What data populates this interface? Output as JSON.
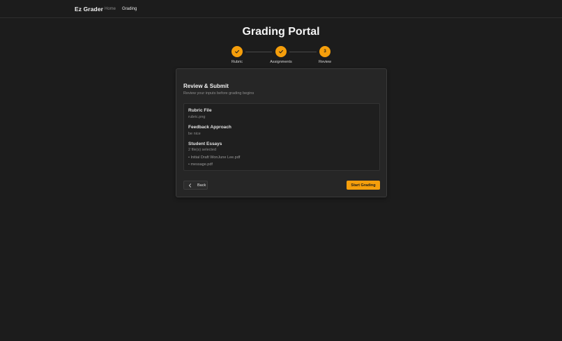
{
  "nav": {
    "brand": "Ez Grader",
    "links": [
      {
        "label": "Home"
      },
      {
        "label": "Grading"
      }
    ]
  },
  "page": {
    "title": "Grading Portal"
  },
  "stepper": {
    "steps": [
      {
        "label": "Rubric",
        "state": "complete",
        "icon": "check-icon"
      },
      {
        "label": "Assignments",
        "state": "complete",
        "icon": "check-icon"
      },
      {
        "label": "Review",
        "state": "current",
        "number": "3"
      }
    ]
  },
  "card": {
    "title": "Review & Submit",
    "subtitle": "Review your inputs before grading begins",
    "sections": {
      "rubric": {
        "label": "Rubric File",
        "value": "rubric.png"
      },
      "feedback": {
        "label": "Feedback Approach",
        "value": "be nice"
      },
      "essays": {
        "label": "Student Essays",
        "value": "2 file(s) selected",
        "files": [
          "• Initial Draft WonJune Lee.pdf",
          "• message.pdf"
        ]
      }
    },
    "back_label": "Back",
    "start_label": "Start Grading"
  },
  "colors": {
    "accent": "#f59e0b",
    "background": "#1c1c1c",
    "card": "#262626"
  }
}
